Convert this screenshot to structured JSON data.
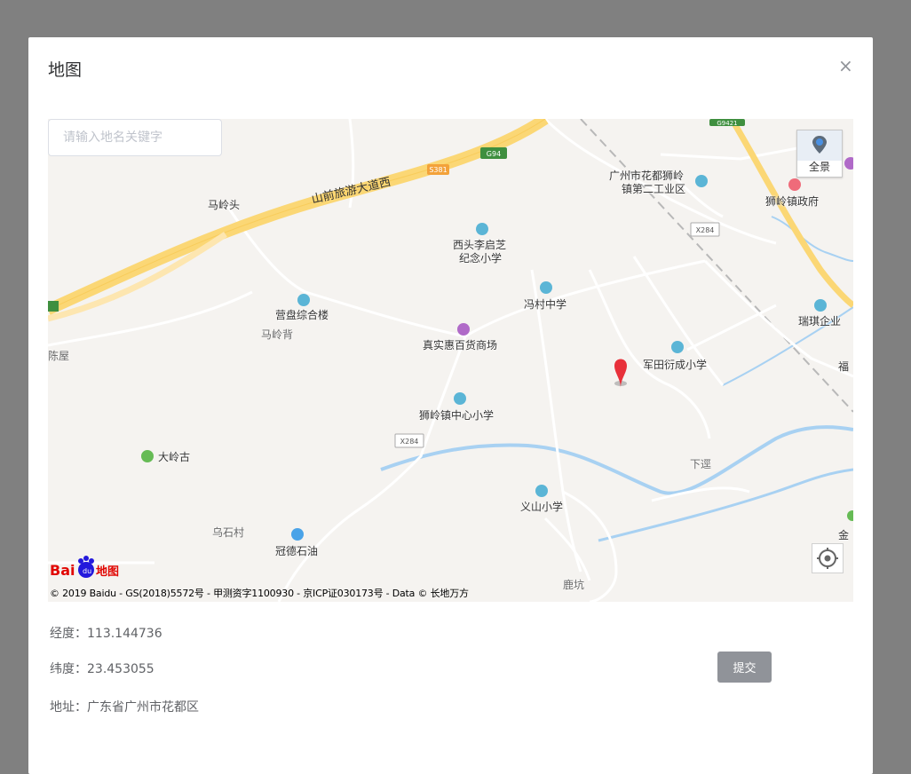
{
  "dialog": {
    "title": "地图",
    "close_glyph": "×"
  },
  "map": {
    "search_placeholder": "请输入地名关键字",
    "panorama_label": "全景",
    "copyright": "© 2019 Baidu - GS(2018)5572号 - 甲测资字1100930 - 京ICP证030173号 - Data © 长地万方",
    "logo_text": "Bai du 地图",
    "road_labels": {
      "expressway": "山前旅游大道西",
      "g94": "G94",
      "s381": "S381",
      "x284_a": "X284",
      "x284_b": "X284",
      "g9421": "G9421"
    },
    "places": [
      "马岭头",
      "西头李启芝",
      "纪念小学",
      "广州市花都狮岭",
      "镇第二工业区",
      "狮岭镇政府",
      "营盘综合楼",
      "冯村中学",
      "马岭背",
      "真实惠百货商场",
      "陈屋",
      "军田衍成小学",
      "瑞琪企业",
      "福",
      "狮岭镇中心小学",
      "大岭古",
      "下逕",
      "义山小学",
      "乌石村",
      "冠德石油",
      "金",
      "鹿坑"
    ]
  },
  "info": {
    "longitude_label": "经度：",
    "longitude_value": "113.144736",
    "latitude_label": "纬度：",
    "latitude_value": "23.453055",
    "address_label": "地址：",
    "address_value": "广东省广州市花都区"
  },
  "actions": {
    "submit_label": "提交"
  }
}
